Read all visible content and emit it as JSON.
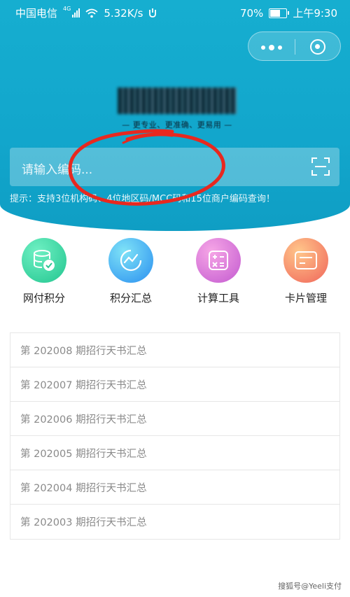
{
  "status_bar": {
    "carrier": "中国电信",
    "network_badge": "4G",
    "speed": "5.32K/s",
    "battery_percent": "70%",
    "battery_level": 0.7,
    "time": "上午9:30"
  },
  "header": {
    "logo_text": "",
    "slogan": "— 更专业、更准确、更易用 —"
  },
  "search": {
    "placeholder": "请输入编码...",
    "hint": "提示：支持3位机构码、4位地区码/MCC码和15位商户编码查询！"
  },
  "quick_actions": [
    {
      "label": "网付积分",
      "icon": "database-check-icon",
      "color": "#2fcf9a"
    },
    {
      "label": "积分汇总",
      "icon": "trend-chart-icon",
      "color": "#39a9f0"
    },
    {
      "label": "计算工具",
      "icon": "calculator-icon",
      "color": "#d86ad6"
    },
    {
      "label": "卡片管理",
      "icon": "card-icon",
      "color": "#f37a5a"
    }
  ],
  "reports": [
    {
      "label": "第 202008 期招行天书汇总"
    },
    {
      "label": "第 202007 期招行天书汇总"
    },
    {
      "label": "第 202006 期招行天书汇总"
    },
    {
      "label": "第 202005 期招行天书汇总"
    },
    {
      "label": "第 202004 期招行天书汇总"
    },
    {
      "label": "第 202003 期招行天书汇总"
    }
  ],
  "watermark": "搜狐号@Yeeli支付",
  "colors": {
    "header_bg": "#14aacd",
    "annotation": "#e8281f"
  }
}
